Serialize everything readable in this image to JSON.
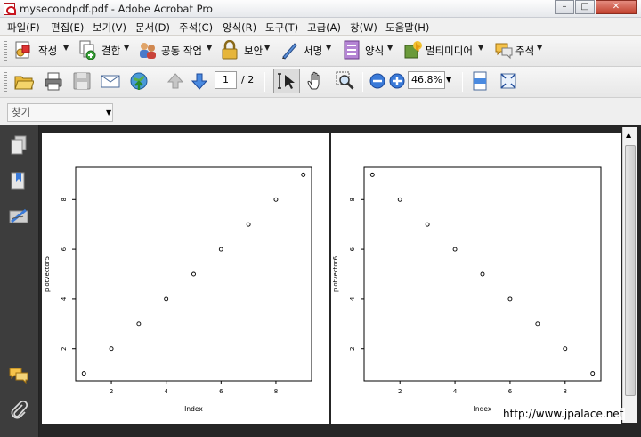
{
  "window": {
    "title": "mysecondpdf.pdf - Adobe Acrobat Pro",
    "controls": {
      "minimize": "–",
      "maximize": "□",
      "close": "✕"
    }
  },
  "menu": [
    "파일(F)",
    "편집(E)",
    "보기(V)",
    "문서(D)",
    "주석(C)",
    "양식(R)",
    "도구(T)",
    "고급(A)",
    "창(W)",
    "도움말(H)"
  ],
  "toolbar_tasks": {
    "create": "작성",
    "combine": "결합",
    "collaborate": "공동 작업",
    "secure": "보안",
    "sign": "서명",
    "forms": "양식",
    "multimedia": "멀티미디어",
    "comment": "주석"
  },
  "navigation": {
    "current_page": "1",
    "total_pages": "/ 2",
    "zoom": "46.8%"
  },
  "find": {
    "placeholder": "찾기"
  },
  "colors": {
    "accent": "#2a6bd1",
    "nav_pane": "#3d3d3d",
    "doc_bg": "#262626"
  },
  "watermark": "http://www.jpalace.net",
  "chart_data": [
    {
      "type": "scatter",
      "x": [
        1,
        2,
        3,
        4,
        5,
        6,
        7,
        8,
        9
      ],
      "y": [
        1,
        2,
        3,
        4,
        5,
        6,
        7,
        8,
        9
      ],
      "xlabel": "Index",
      "ylabel": "plotvector5",
      "xlim": [
        0.7,
        9.3
      ],
      "ylim": [
        0.7,
        9.3
      ],
      "xticks": [
        2,
        4,
        6,
        8
      ],
      "yticks": [
        2,
        4,
        6,
        8
      ]
    },
    {
      "type": "scatter",
      "x": [
        1,
        2,
        3,
        4,
        5,
        6,
        7,
        8,
        9
      ],
      "y": [
        9,
        8,
        7,
        6,
        5,
        4,
        3,
        2,
        1
      ],
      "xlabel": "Index",
      "ylabel": "plotvector6",
      "xlim": [
        0.7,
        9.3
      ],
      "ylim": [
        0.7,
        9.3
      ],
      "xticks": [
        2,
        4,
        6,
        8
      ],
      "yticks": [
        2,
        4,
        6,
        8
      ]
    }
  ]
}
